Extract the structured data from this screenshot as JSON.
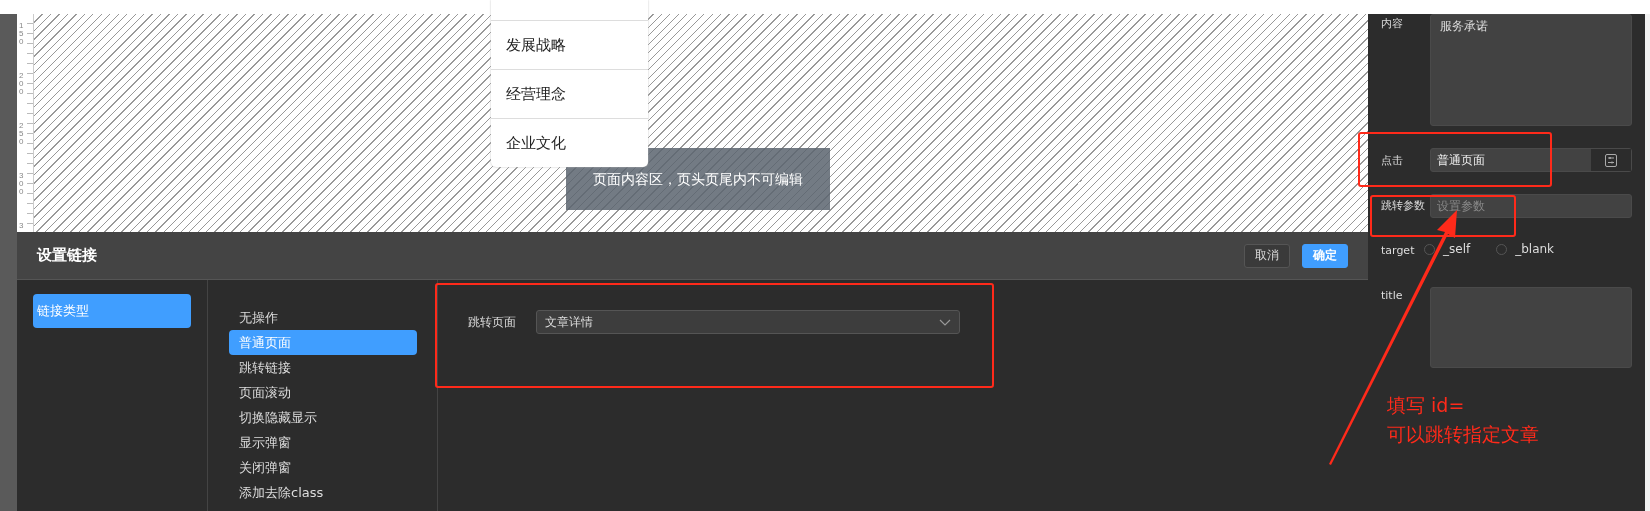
{
  "ruler": {
    "labels": [
      "150",
      "200",
      "250",
      "300",
      "3"
    ]
  },
  "canvas": {
    "menu_items": [
      "发展战略",
      "经营理念",
      "企业文化"
    ],
    "notice": "页面内容区，页头页尾内不可编辑"
  },
  "dialog": {
    "title": "设置链接",
    "buttons": [
      {
        "label": "取消",
        "kind": "plain"
      },
      {
        "label": "确定",
        "kind": "primary"
      }
    ],
    "categories": [
      {
        "label": "链接类型",
        "selected": true
      }
    ],
    "link_types": [
      {
        "label": "无操作",
        "selected": false
      },
      {
        "label": "普通页面",
        "selected": true
      },
      {
        "label": "跳转链接",
        "selected": false
      },
      {
        "label": "页面滚动",
        "selected": false
      },
      {
        "label": "切换隐藏显示",
        "selected": false
      },
      {
        "label": "显示弹窗",
        "selected": false
      },
      {
        "label": "关闭弹窗",
        "selected": false
      },
      {
        "label": "添加去除class",
        "selected": false
      }
    ],
    "field": {
      "label": "跳转页面",
      "value": "文章详情"
    }
  },
  "panel": {
    "content": {
      "label": "内容",
      "value": "服务承诺"
    },
    "click": {
      "label": "点击",
      "value": "普通页面"
    },
    "params": {
      "label": "跳转参数",
      "placeholder": "设置参数"
    },
    "target": {
      "label": "target",
      "options": [
        {
          "label": "_self",
          "selected": false
        },
        {
          "label": "_blank",
          "selected": false
        }
      ]
    },
    "title": {
      "label": "title"
    }
  },
  "annotation": {
    "lines": [
      "填写 id=",
      "可以跳转指定文章"
    ]
  }
}
